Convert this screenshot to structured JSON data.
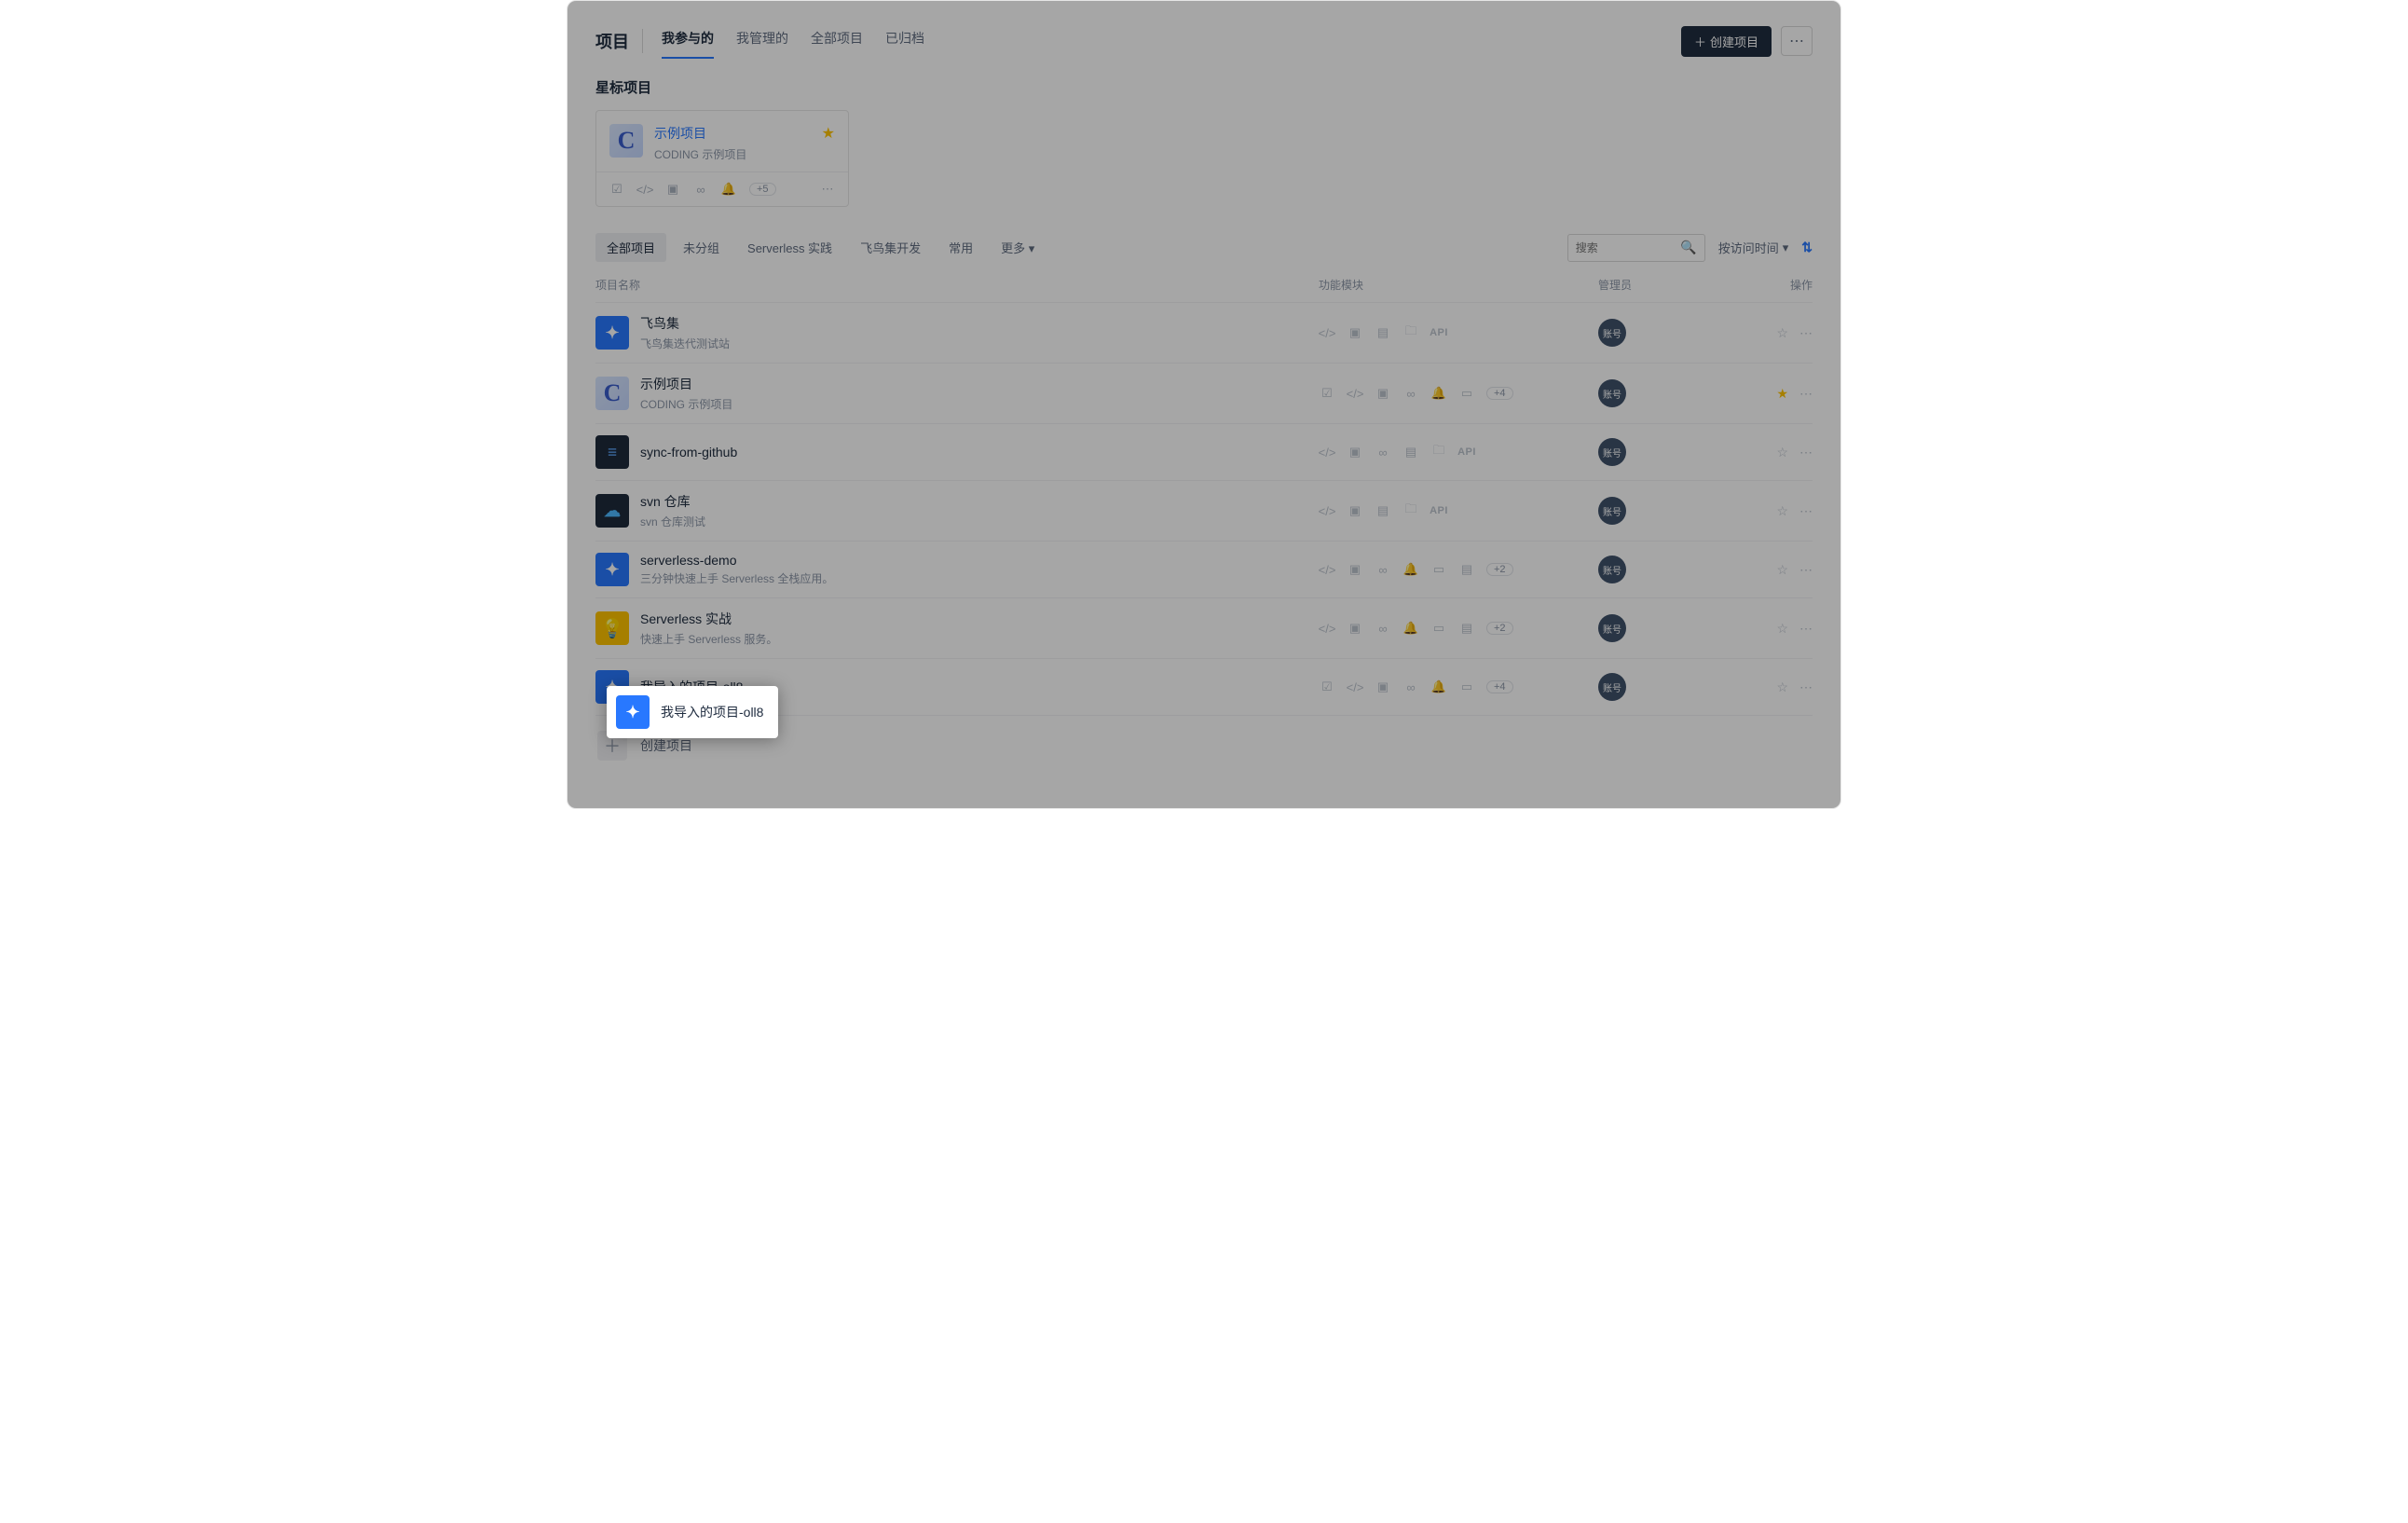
{
  "header": {
    "title": "项目",
    "tabs": [
      "我参与的",
      "我管理的",
      "全部项目",
      "已归档"
    ],
    "active_tab_index": 0,
    "create_btn": "创建项目"
  },
  "starred_section": {
    "title": "星标项目",
    "card": {
      "title": "示例项目",
      "subtitle": "CODING 示例项目",
      "extra_badge": "+5"
    }
  },
  "filters": {
    "tabs": [
      "全部项目",
      "未分组",
      "Serverless 实践",
      "飞鸟集开发",
      "常用",
      "更多"
    ],
    "active_index": 0,
    "search_placeholder": "搜索",
    "sort_label": "按访问时间"
  },
  "table": {
    "headers": [
      "项目名称",
      "功能模块",
      "管理员",
      "操作"
    ],
    "admin_badge": "账号",
    "rows": [
      {
        "title": "飞鸟集",
        "sub": "飞鸟集迭代测试站",
        "modules": [
          "code",
          "terminal",
          "ci",
          "folder",
          "api"
        ],
        "starred": false,
        "icon": "rocket"
      },
      {
        "title": "示例项目",
        "sub": "CODING 示例项目",
        "modules": [
          "check",
          "code",
          "terminal",
          "infinity",
          "bell",
          "window"
        ],
        "more": "+4",
        "starred": true,
        "icon": "c"
      },
      {
        "title": "sync-from-github",
        "sub": "",
        "modules": [
          "code",
          "terminal",
          "infinity",
          "ci",
          "folder",
          "api"
        ],
        "starred": false,
        "icon": "db"
      },
      {
        "title": "svn 仓库",
        "sub": "svn 仓库测试",
        "modules": [
          "code",
          "terminal",
          "ci",
          "folder",
          "api"
        ],
        "starred": false,
        "icon": "cloud"
      },
      {
        "title": "serverless-demo",
        "sub": "三分钟快速上手 Serverless 全栈应用。",
        "modules": [
          "code",
          "terminal",
          "infinity",
          "bell",
          "window",
          "ci"
        ],
        "more": "+2",
        "starred": false,
        "icon": "rocket"
      },
      {
        "title": "Serverless 实战",
        "sub": "快速上手 Serverless 服务。",
        "modules": [
          "code",
          "terminal",
          "infinity",
          "bell",
          "window",
          "ci"
        ],
        "more": "+2",
        "starred": false,
        "icon": "bulb"
      },
      {
        "title": "我导入的项目-oll8",
        "sub": "",
        "modules": [
          "check",
          "code",
          "terminal",
          "infinity",
          "bell",
          "window"
        ],
        "more": "+4",
        "starred": false,
        "icon": "rocket",
        "highlighted": true
      }
    ],
    "create_project_label": "创建项目"
  },
  "highlight": {
    "title": "我导入的项目-oll8"
  }
}
